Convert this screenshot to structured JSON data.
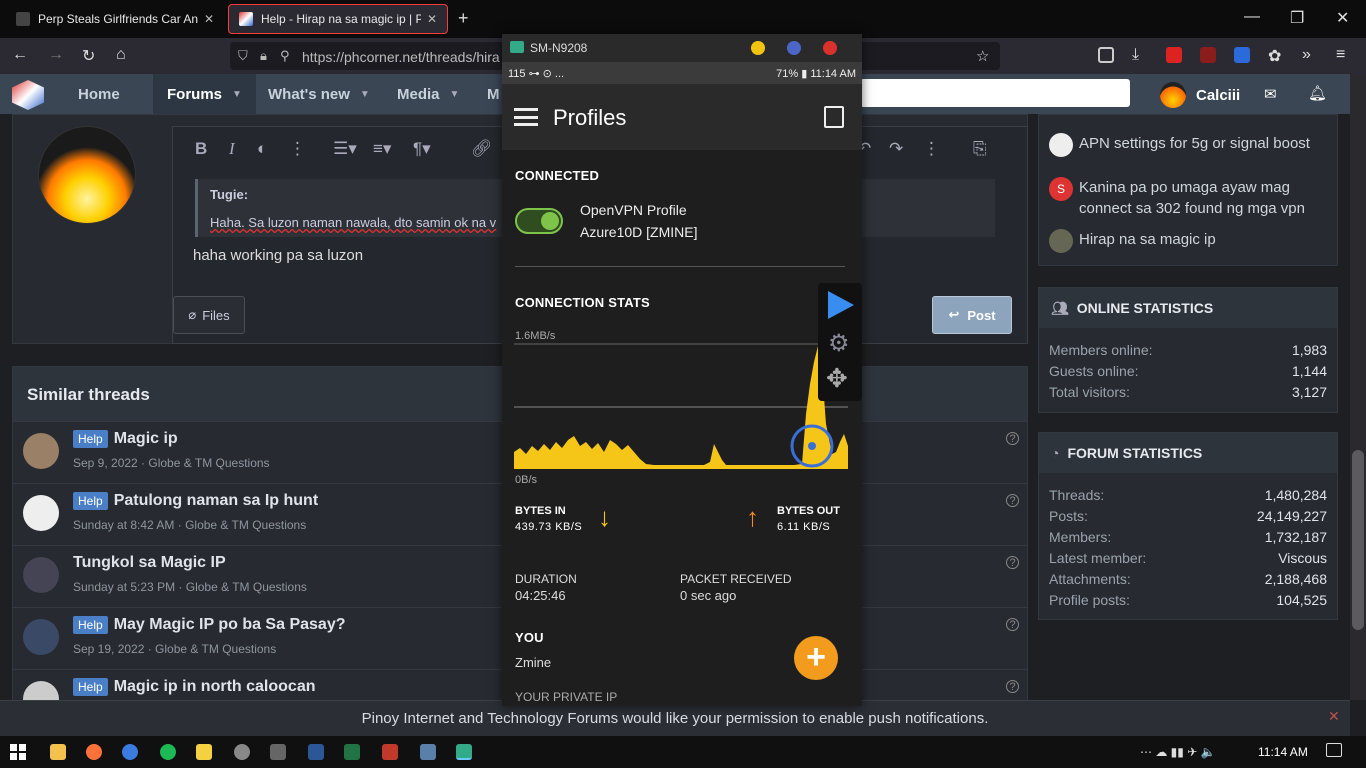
{
  "browser": {
    "tabs": [
      {
        "title": "Perp Steals Girlfriends Car And",
        "favicon_color": "#222222"
      },
      {
        "title": "Help - Hirap na sa magic ip | Pi",
        "favicon_color": "#3a6fd8"
      }
    ],
    "url": "https://phcorner.net/threads/hira",
    "new_tab": "+",
    "minimize": "—",
    "maximize": "❐",
    "close": "✕"
  },
  "site": {
    "nav": [
      "Home",
      "Forums",
      "What's new",
      "Media",
      "M"
    ],
    "active_nav": "Forums",
    "username": "Calciii"
  },
  "editor": {
    "quote_author": "Tugie:",
    "quote_text": "Haha. Sa luzon naman nawala, dto samin ok na v",
    "reply_text": "haha working pa sa luzon",
    "files_label": "Files",
    "post_label": "Post"
  },
  "similar": {
    "title": "Similar threads",
    "threads": [
      {
        "badge": "Help",
        "title": "Magic ip",
        "meta": "Sep 9, 2022 · Globe & TM Questions"
      },
      {
        "badge": "Help",
        "title": "Patulong naman sa Ip hunt",
        "meta": "Sunday at 8:42 AM · Globe & TM Questions"
      },
      {
        "badge": "",
        "title": "Tungkol sa Magic IP",
        "meta": "Sunday at 5:23 PM · Globe & TM Questions"
      },
      {
        "badge": "Help",
        "title": "May Magic IP po ba Sa Pasay?",
        "meta": "Sep 19, 2022 · Globe & TM Questions"
      },
      {
        "badge": "Help",
        "title": "Magic ip in north caloocan",
        "meta": ""
      }
    ]
  },
  "sidebar": {
    "latest": [
      {
        "text": "APN settings for 5g or signal boost"
      },
      {
        "text": "Kanina pa po umaga ayaw mag connect sa 302 found ng mga vpn",
        "initial": "S"
      },
      {
        "text": "Hirap na sa magic ip"
      }
    ],
    "online": {
      "title": "ONLINE STATISTICS",
      "rows": [
        {
          "label": "Members online:",
          "value": "1,983"
        },
        {
          "label": "Guests online:",
          "value": "1,144"
        },
        {
          "label": "Total visitors:",
          "value": "3,127"
        }
      ]
    },
    "forum": {
      "title": "FORUM STATISTICS",
      "rows": [
        {
          "label": "Threads:",
          "value": "1,480,284"
        },
        {
          "label": "Posts:",
          "value": "24,149,227"
        },
        {
          "label": "Members:",
          "value": "1,732,187"
        },
        {
          "label": "Latest member:",
          "value": "Viscous"
        },
        {
          "label": "Attachments:",
          "value": "2,188,468"
        },
        {
          "label": "Profile posts:",
          "value": "104,525"
        }
      ]
    }
  },
  "push_notice": "Pinoy Internet and Technology Forums would like your permission to enable push notifications.",
  "push_close": "✕",
  "phone": {
    "device": "SM-N9208",
    "status_left": "115 ⊶ ⊙ ...",
    "status_right": "71% ▮ 11:14 AM",
    "app_title": "Profiles",
    "connected_label": "CONNECTED",
    "profile_name": "OpenVPN Profile",
    "profile_server": "Azure10D [ZMINE]",
    "stats_label": "CONNECTION STATS",
    "y_max": "1.6MB/s",
    "y_min": "0B/s",
    "bytes_in_label": "BYTES IN",
    "bytes_in_value": "439.73 KB/S",
    "bytes_out_label": "BYTES OUT",
    "bytes_out_value": "6.11 KB/S",
    "duration_label": "DURATION",
    "duration_value": "04:25:46",
    "packet_label": "PACKET RECEIVED",
    "packet_value": "0 sec ago",
    "you_label": "YOU",
    "you_value": "Zmine",
    "private_ip_label": "YOUR PRIVATE IP",
    "fab": "+",
    "arrow_in": "↓",
    "arrow_out": "↑",
    "colors": {
      "toggle": "#7ec34a",
      "accent": "#f29b1d",
      "chart_fill": "#f5c518",
      "play": "#3a8df0"
    }
  },
  "taskbar": {
    "clock": "11:14 AM",
    "tray": "⋯ ☁ ▮▮ ✈ 🔈"
  }
}
